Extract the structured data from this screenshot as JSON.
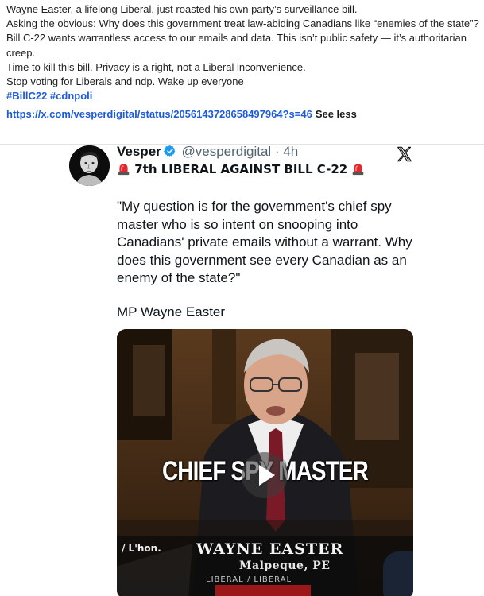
{
  "post": {
    "line1": "Wayne Easter, a lifelong Liberal, just roasted his own party’s surveillance bill.",
    "line2": "Asking the obvious: Why does this government treat law-abiding Canadians like “enemies of the state”?",
    "line3": "Bill C-22 wants warrantless access to our emails and data. This isn’t public safety — it’s authoritarian creep.",
    "line4": "Time to kill this bill. Privacy is a right, not a Liberal inconvenience.",
    "line5": "Stop voting for Liberals and ndp. Wake up everyone",
    "hashtags": "#BillC22 #cdnpoli",
    "link": "https://x.com/vesperdigital/status/2056143728658497964?s=46",
    "see_less": "See less"
  },
  "embed": {
    "display_name": "Vesper",
    "handle": "@vesperdigital · 4h",
    "headline": " 7th LIBERAL AGAINST BILL C-22 ",
    "quote": "\"My question is for the government's chief spy master who is so intent on snooping into Canadians' private emails without a warrant. Why does this government see every Canadian as an enemy of the state?\"",
    "attribution": "MP Wayne Easter",
    "icons": {
      "avatar": "avatar-portrait",
      "verified": "verified-badge-icon",
      "platform": "x-logo-icon",
      "siren": "siren-icon",
      "play": "play-icon"
    },
    "colors": {
      "link": "#1d5bd8",
      "verified": "#1d9bf0",
      "handle": "#536471"
    }
  },
  "video": {
    "overlay_title": "CHIEF SPY MASTER",
    "lower_third_prefix": "/ L'hon.",
    "lower_third_name": "WAYNE EASTER",
    "lower_third_riding": "Malpeque, PE",
    "lower_third_party": "LIBERAL / LIBÉRAL"
  }
}
